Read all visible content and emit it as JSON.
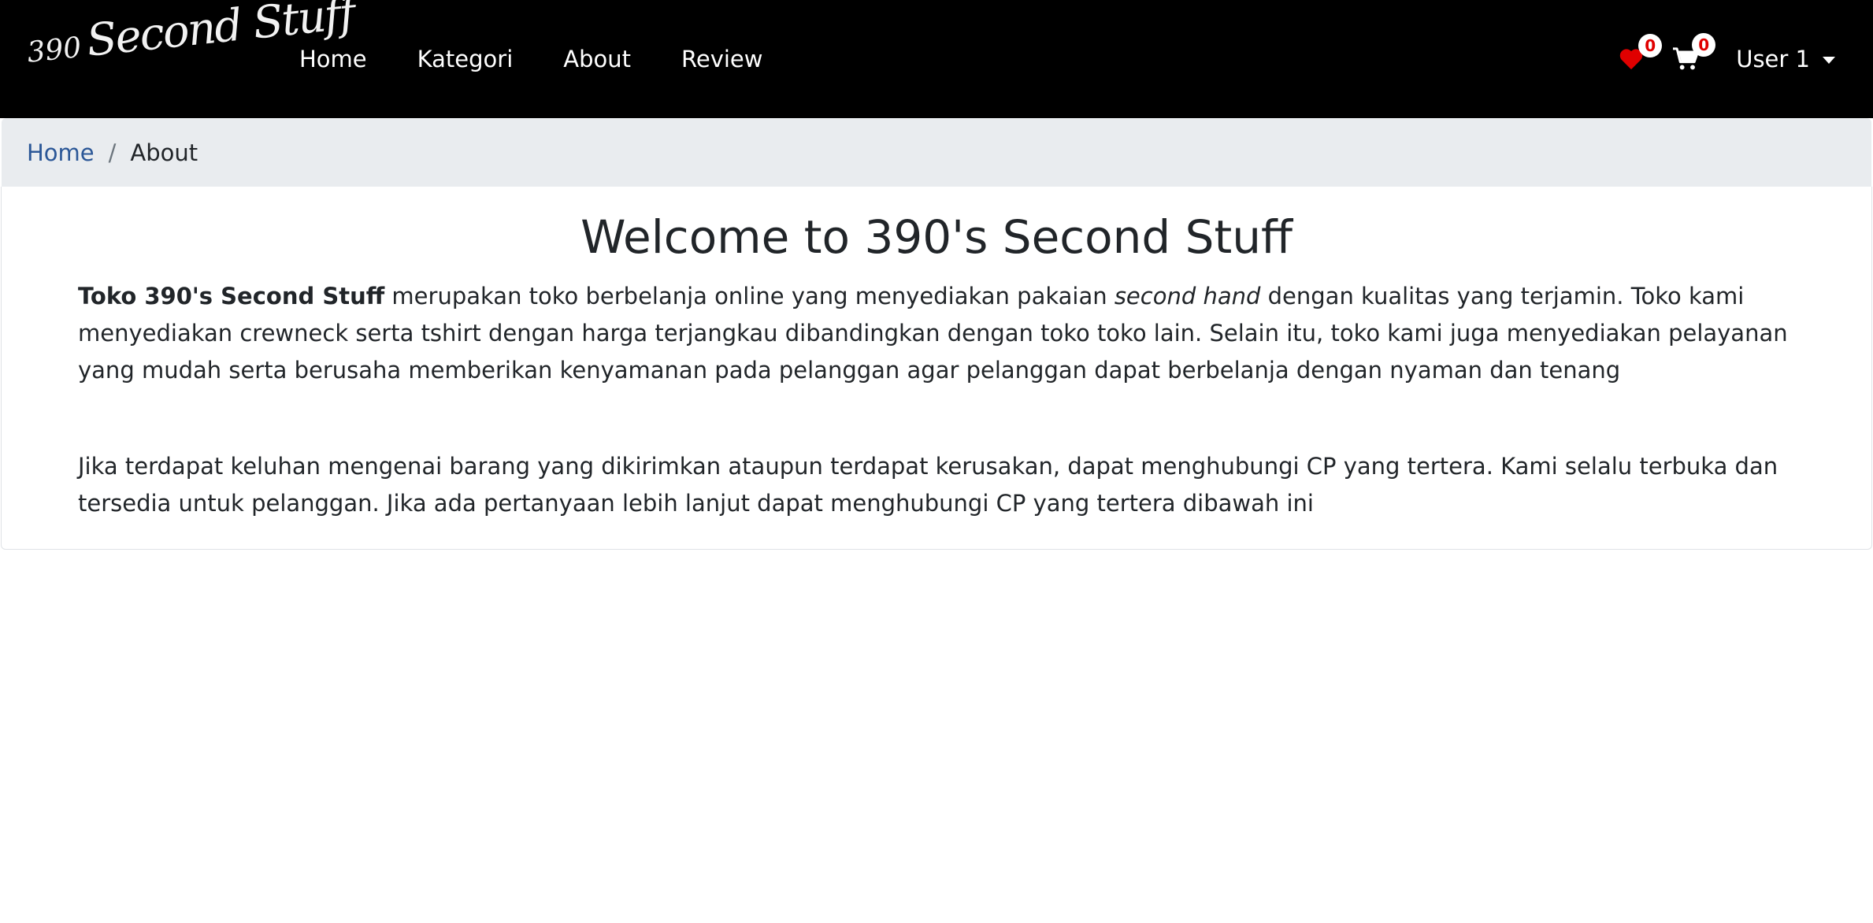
{
  "brand": {
    "number": "390",
    "script": "Second Stuff"
  },
  "nav": {
    "items": [
      {
        "label": "Home"
      },
      {
        "label": "Kategori"
      },
      {
        "label": "About"
      },
      {
        "label": "Review"
      }
    ],
    "wishlist_count": "0",
    "cart_count": "0",
    "user_label": "User 1"
  },
  "breadcrumb": {
    "home": "Home",
    "separator": "/",
    "current": "About"
  },
  "main": {
    "title": "Welcome to 390's Second Stuff",
    "paragraph1": {
      "bold_lead": "Toko 390's Second Stuff",
      "text_before_italic": " merupakan toko berbelanja online yang menyediakan pakaian ",
      "italic": "second hand",
      "text_after_italic": " dengan kualitas yang terjamin. Toko kami menyediakan crewneck serta tshirt dengan harga terjangkau dibandingkan dengan toko toko lain. Selain itu, toko kami juga menyediakan pelayanan yang mudah serta berusaha memberikan kenyamanan pada pelanggan agar pelanggan dapat berbelanja dengan nyaman dan tenang"
    },
    "paragraph2": "Jika terdapat keluhan mengenai barang yang dikirimkan ataupun terdapat kerusakan, dapat menghubungi CP yang tertera. Kami selalu terbuka dan tersedia untuk pelanggan. Jika ada pertanyaan lebih lanjut dapat menghubungi CP yang tertera dibawah ini"
  },
  "colors": {
    "navbar_bg": "#000000",
    "wishlist_heart": "#e00000",
    "breadcrumb_bg": "#e9ecef",
    "link": "#2b5797"
  },
  "icons": {
    "wishlist": "heart-icon",
    "cart": "cart-icon",
    "user_dropdown": "chevron-down-icon"
  }
}
